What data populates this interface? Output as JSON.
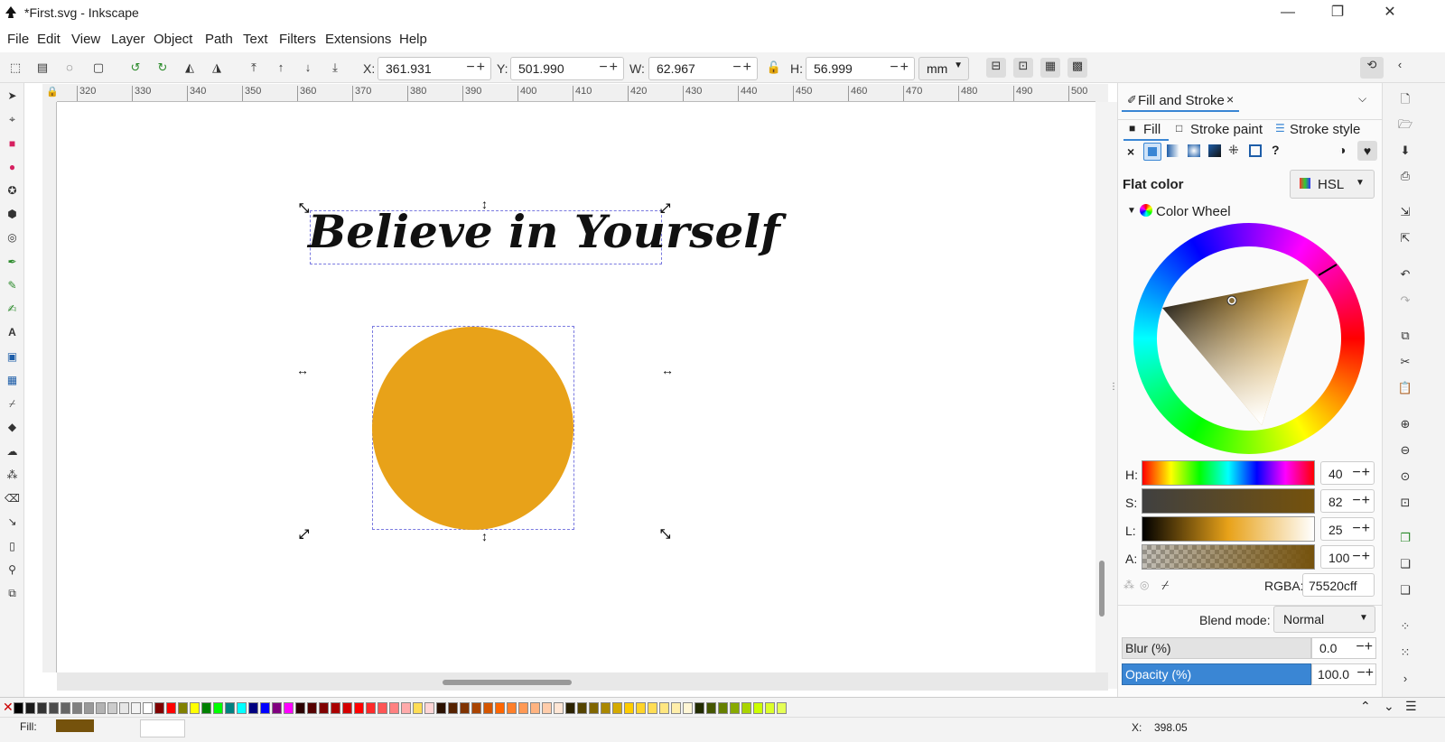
{
  "window": {
    "title": "*First.svg - Inkscape",
    "minimize": "—",
    "restore": "❐",
    "close": "✕"
  },
  "menu": [
    "File",
    "Edit",
    "View",
    "Layer",
    "Object",
    "Path",
    "Text",
    "Filters",
    "Extensions",
    "Help"
  ],
  "toolbar": {
    "x_label": "X:",
    "x_value": "361.931",
    "y_label": "Y:",
    "y_value": "501.990",
    "w_label": "W:",
    "w_value": "62.967",
    "h_label": "H:",
    "h_value": "56.999",
    "unit": "mm",
    "pm": "−+"
  },
  "ruler": {
    "ticks": [
      "320",
      "330",
      "340",
      "350",
      "360",
      "370",
      "380",
      "390",
      "400",
      "410",
      "420",
      "430",
      "440",
      "450",
      "460",
      "470",
      "480",
      "490",
      "500"
    ]
  },
  "canvas": {
    "text": "Believe in Yourself",
    "circle_color": "#e8a219"
  },
  "panel": {
    "tab_title": "Fill and Stroke",
    "tab_close": "×",
    "subtabs": {
      "fill": "Fill",
      "stroke_paint": "Stroke paint",
      "stroke_style": "Stroke style"
    },
    "paint_none": "×",
    "paint_unknown": "?",
    "flat_color_label": "Flat color",
    "mode": "HSL",
    "wheel_label": "Color Wheel",
    "sliders": [
      {
        "label": "H:",
        "value": "40"
      },
      {
        "label": "S:",
        "value": "82"
      },
      {
        "label": "L:",
        "value": "25"
      },
      {
        "label": "A:",
        "value": "100"
      }
    ],
    "rgba_label": "RGBA:",
    "rgba_value": "75520cff",
    "blend_label": "Blend mode:",
    "blend_value": "Normal",
    "blur_label": "Blur (%)",
    "blur_value": "0.0",
    "opacity_label": "Opacity (%)",
    "opacity_value": "100.0"
  },
  "status": {
    "fill_label": "Fill:",
    "fill_color": "#75520c",
    "x_label": "X:",
    "x_value": "398.05"
  },
  "colors": {
    "accent": "#3a86d4",
    "circle": "#e8a219",
    "flat": "#75520c"
  }
}
